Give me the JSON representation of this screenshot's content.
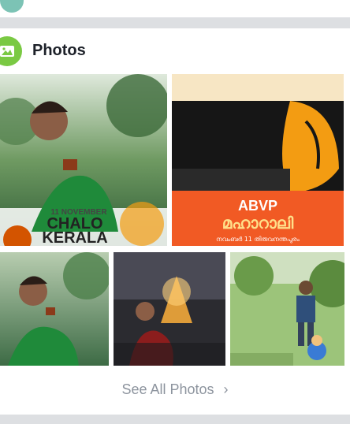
{
  "previous_section": {
    "label": "",
    "icon": "location-pin-icon"
  },
  "photos_section": {
    "title": "Photos",
    "icon": "photo-icon",
    "see_all_label": "See All Photos",
    "see_all_icon": "chevron-right-icon"
  },
  "photos": [
    {
      "name": "photo-chalo-kerala",
      "overlay_text": [
        "11 NOVEMBER",
        "CHALO",
        "KERALA"
      ]
    },
    {
      "name": "photo-abvp-poster",
      "overlay_text": [
        "ABVP",
        "മഹാറാലി",
        "നവംബർ 11 തിരുവനന്തപുരം"
      ]
    },
    {
      "name": "photo-man-drinking-tea"
    },
    {
      "name": "photo-man-with-lamp"
    },
    {
      "name": "photo-man-in-field"
    }
  ],
  "colors": {
    "accent_green": "#7ac943",
    "secondary_text": "#8d949e",
    "title_text": "#1d2129",
    "abvp_orange": "#f15a24"
  }
}
